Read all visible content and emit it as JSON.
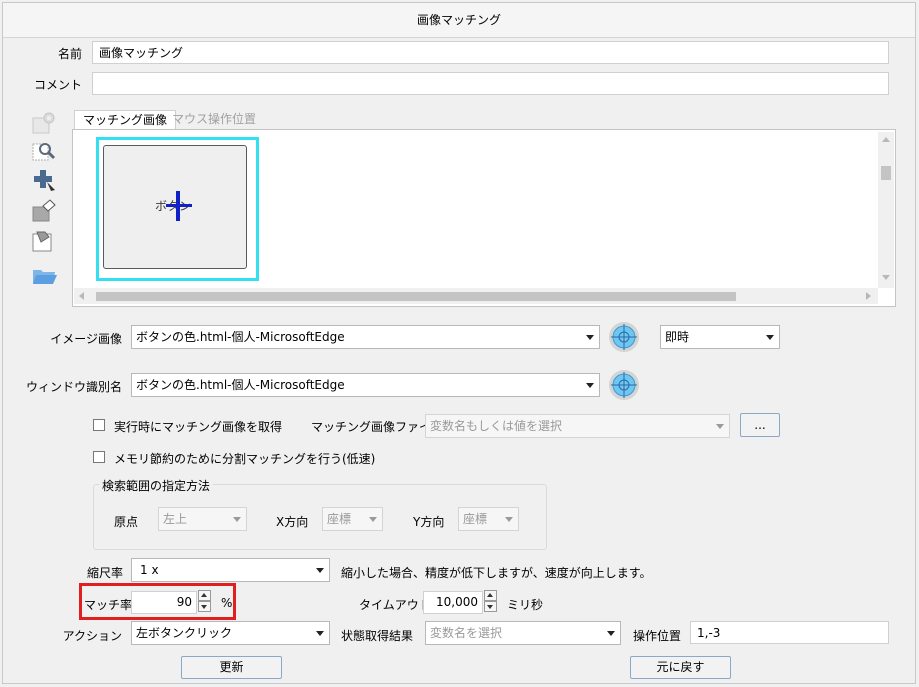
{
  "window": {
    "title": "画像マッチング"
  },
  "fields": {
    "name_label": "名前",
    "name_value": "画像マッチング",
    "comment_label": "コメント",
    "comment_value": ""
  },
  "tabs": [
    {
      "label": "マッチング画像"
    },
    {
      "label": "マウス操作位置"
    }
  ],
  "preview": {
    "button_text": "ボタン"
  },
  "image": {
    "label": "イメージ画像",
    "value": "ボタンの色.html-個人-MicrosoftEdge",
    "timing": "即時"
  },
  "window_id": {
    "label": "ウィンドウ識別名",
    "value": "ボタンの色.html-個人-MicrosoftEdge"
  },
  "options": {
    "capture_label": "実行時にマッチング画像を取得",
    "file_label": "マッチング画像ファイル",
    "file_placeholder": "変数名もしくは値を選択",
    "browse_label": "...",
    "split_label": "メモリ節約のために分割マッチングを行う(低速)"
  },
  "search_range": {
    "title": "検索範囲の指定方法",
    "origin_label": "原点",
    "origin_value": "左上",
    "x_label": "X方向",
    "x_value": "座標",
    "y_label": "Y方向",
    "y_value": "座標"
  },
  "scale": {
    "label": "縮尺率",
    "value": "1 x",
    "note": "縮小した場合、精度が低下しますが、速度が向上します。"
  },
  "match": {
    "label": "マッチ率",
    "value": "90",
    "unit": "%",
    "highlight_color": "#e02020"
  },
  "timeout": {
    "label": "タイムアウト",
    "value": "10,000",
    "unit": "ミリ秒"
  },
  "action": {
    "label": "アクション",
    "value": "左ボタンクリック",
    "state_label": "状態取得結果",
    "state_placeholder": "変数名を選択",
    "pos_label": "操作位置",
    "pos_value": "1,-3"
  },
  "buttons": {
    "update": "更新",
    "revert": "元に戻す"
  },
  "colors": {
    "selection_border": "#33e0f0",
    "accent_blue": "#3b7fd0"
  }
}
